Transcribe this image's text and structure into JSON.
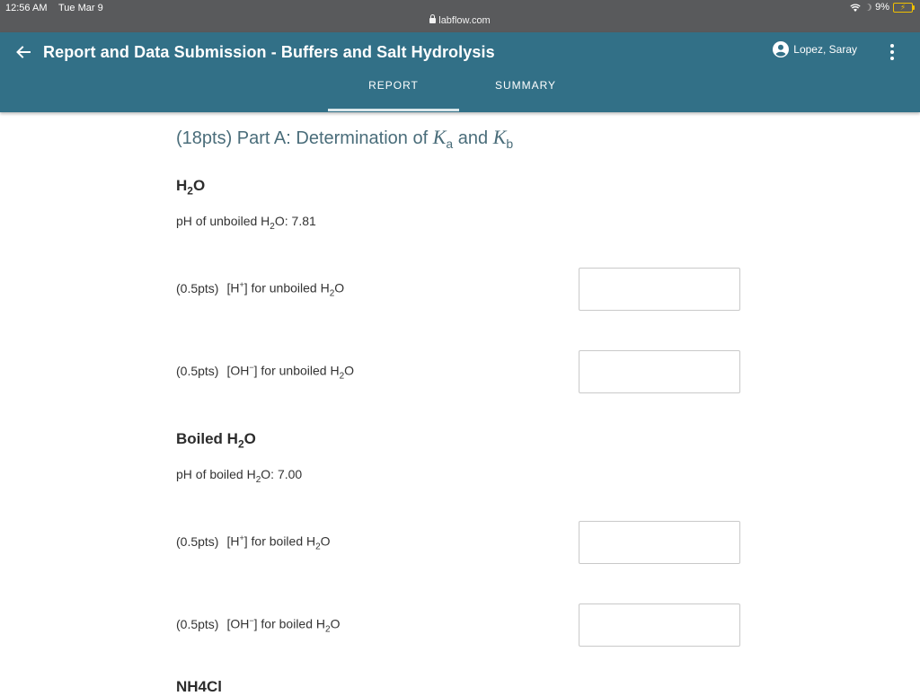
{
  "status_bar": {
    "time": "12:56 AM",
    "date": "Tue Mar 9",
    "url": "labflow.com",
    "battery": "9%"
  },
  "header": {
    "title": "Report and Data Submission - Buffers and Salt Hydrolysis",
    "user": "Lopez, Saray",
    "tabs": [
      {
        "label": "REPORT",
        "selected": true
      },
      {
        "label": "SUMMARY",
        "selected": false
      }
    ],
    "bg_color": "#327087"
  },
  "content": {
    "part_title_prefix": "(18pts) Part A: Determination of",
    "part_title_ka": "K",
    "part_title_a": "a",
    "part_title_and": "and",
    "part_title_kb": "K",
    "part_title_b": "b",
    "sections": [
      {
        "heading_main": "H",
        "heading_sub": "2",
        "heading_tail": "O",
        "ph_prefix": "pH of unboiled H",
        "ph_sub": "2",
        "ph_tail": "O: 7.81",
        "questions": [
          {
            "pts": "(0.5pts)",
            "ion": "[H",
            "ion_sup": "+",
            "ion_close": "]",
            "text": "for unboiled H",
            "sub": "2",
            "tail": "O",
            "value": ""
          },
          {
            "pts": "(0.5pts)",
            "ion": "[OH",
            "ion_sup": "−",
            "ion_close": "]",
            "text": "for unboiled H",
            "sub": "2",
            "tail": "O",
            "value": ""
          }
        ]
      },
      {
        "heading_main": "Boiled H",
        "heading_sub": "2",
        "heading_tail": "O",
        "ph_prefix": "pH of boiled H",
        "ph_sub": "2",
        "ph_tail": "O: 7.00",
        "questions": [
          {
            "pts": "(0.5pts)",
            "ion": "[H",
            "ion_sup": "+",
            "ion_close": "]",
            "text": "for boiled H",
            "sub": "2",
            "tail": "O",
            "value": ""
          },
          {
            "pts": "(0.5pts)",
            "ion": "[OH",
            "ion_sup": "−",
            "ion_close": "]",
            "text": "for boiled H",
            "sub": "2",
            "tail": "O",
            "value": ""
          }
        ]
      }
    ],
    "next_heading": "NH4Cl"
  }
}
